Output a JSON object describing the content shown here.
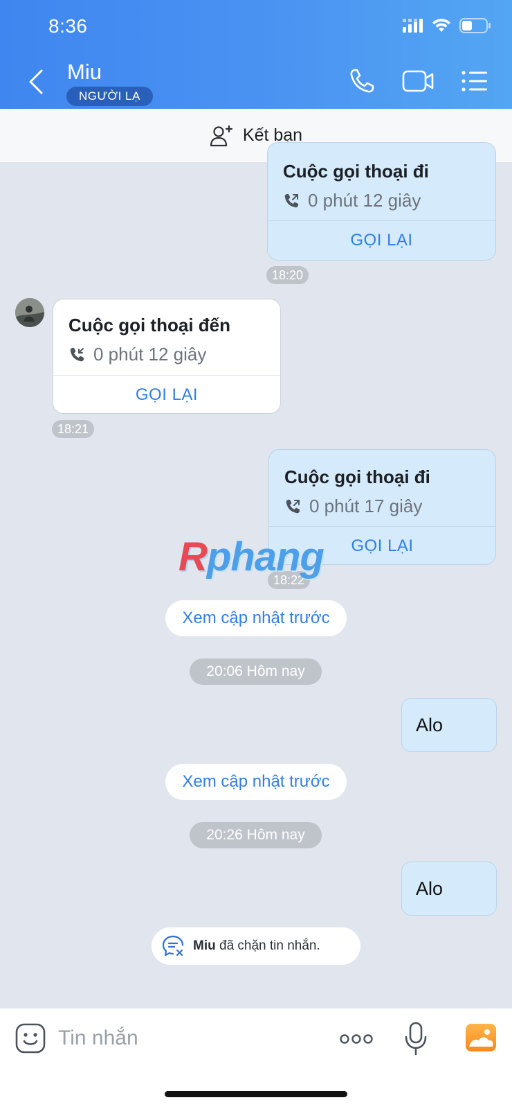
{
  "status_bar": {
    "time": "8:36"
  },
  "header": {
    "contact_name": "Miu",
    "badge": "NGƯỜI LẠ",
    "icons": [
      "back-icon",
      "phone-icon",
      "video-icon",
      "menu-list-icon"
    ]
  },
  "add_friend": {
    "label": "Kết bạn",
    "icon": "add-user-icon"
  },
  "messages": {
    "call1": {
      "title": "Cuộc gọi thoại đi",
      "duration": "0 phút 12 giây",
      "callback": "GỌI LẠI",
      "time": "18:20"
    },
    "call2": {
      "title": "Cuộc gọi thoại đến",
      "duration": "0 phút 12 giây",
      "callback": "GỌI LẠI",
      "time": "18:21"
    },
    "call3": {
      "title": "Cuộc gọi thoại đi",
      "duration": "0 phút 17 giây",
      "callback": "GỌI LẠI",
      "time": "18:22"
    },
    "see_previous_1": "Xem cập nhật trước",
    "date1": "20:06 Hôm nay",
    "text1": "Alo",
    "see_previous_2": "Xem cập nhật trước",
    "date2": "20:26 Hôm nay",
    "text2": "Alo"
  },
  "blocked_notice": {
    "name": "Miu",
    "text": " đã chặn tin nhắn."
  },
  "watermark": {
    "first": "R",
    "rest": "phang"
  },
  "composer": {
    "placeholder": "Tin nhắn",
    "icons": [
      "emoji-icon",
      "more-icon",
      "microphone-icon",
      "gallery-icon"
    ]
  },
  "colors": {
    "header_start": "#3f86f0",
    "header_end": "#53a6f3",
    "accent": "#2f7ee6",
    "outgoing_bubble": "#d5ebfb",
    "chat_bg": "#e1e6ee"
  }
}
